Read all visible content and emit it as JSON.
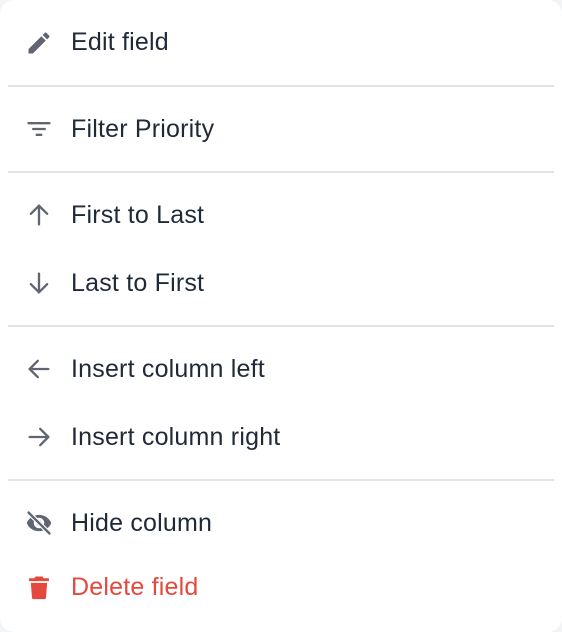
{
  "menu": {
    "items": [
      {
        "label": "Edit field",
        "icon": "pencil-icon"
      },
      {
        "label": "Filter Priority",
        "icon": "filter-icon"
      },
      {
        "label": "First to Last",
        "icon": "arrow-up-icon"
      },
      {
        "label": "Last to First",
        "icon": "arrow-down-icon"
      },
      {
        "label": "Insert column left",
        "icon": "arrow-left-icon"
      },
      {
        "label": "Insert column right",
        "icon": "arrow-right-icon"
      },
      {
        "label": "Hide column",
        "icon": "eye-off-icon"
      },
      {
        "label": "Delete field",
        "icon": "trash-icon"
      }
    ]
  },
  "colors": {
    "text": "#1f2937",
    "icon": "#5f6672",
    "danger": "#e5483d",
    "divider": "#e3e3e3"
  }
}
